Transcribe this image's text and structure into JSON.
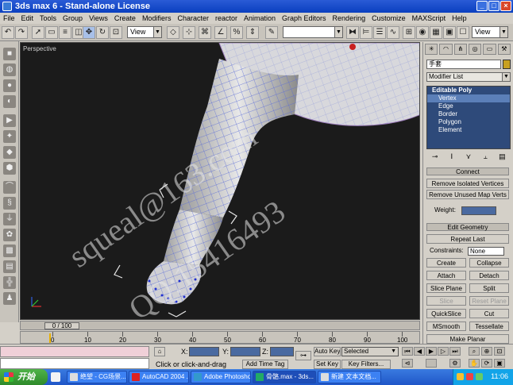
{
  "window": {
    "title": "3ds max 6 - Stand-alone License",
    "controls": [
      "_",
      "□",
      "×"
    ]
  },
  "menu": [
    "File",
    "Edit",
    "Tools",
    "Group",
    "Views",
    "Create",
    "Modifiers",
    "Character",
    "reactor",
    "Animation",
    "Graph Editors",
    "Rendering",
    "Customize",
    "MAXScript",
    "Help"
  ],
  "toolbar": {
    "view_select_1": "View",
    "view_select_2": "View"
  },
  "viewport": {
    "label": "Perspective",
    "watermark_1": "squeal@163.com",
    "watermark_2": "QQ:15416493"
  },
  "command_panel": {
    "object_name": "手套",
    "modifier_list": "Modifier List",
    "stack": {
      "top": "Editable Poly",
      "items": [
        "Vertex",
        "Edge",
        "Border",
        "Polygon",
        "Element"
      ],
      "selected": "Vertex"
    },
    "rollout_top": "Connect",
    "remove_isolated": "Remove Isolated Vertices",
    "remove_unused": "Remove Unused Map Verts",
    "weight_label": "Weight:",
    "edit_geometry": "Edit Geometry",
    "repeat_last": "Repeat Last",
    "constraints_label": "Constraints:",
    "constraints_value": "None",
    "create": "Create",
    "collapse": "Collapse",
    "attach": "Attach",
    "detach": "Detach",
    "slice_plane": "Slice Plane",
    "split": "Split",
    "slice": "Slice",
    "reset_plane": "Reset Plane",
    "quickslice": "QuickSlice",
    "cut": "Cut",
    "msmooth": "MSmooth",
    "tessellate": "Tessellate",
    "make_planar": "Make Planar"
  },
  "timeline": {
    "slider": "0 / 100",
    "ticks": [
      "0",
      "10",
      "20",
      "30",
      "40",
      "50",
      "60",
      "70",
      "80",
      "90",
      "100"
    ]
  },
  "status": {
    "x_label": "X:",
    "y_label": "Y:",
    "z_label": "Z:",
    "prompt": "Click or click-and-drag",
    "add_time_tag": "Add Time Tag",
    "auto_key": "Auto Key",
    "set_key": "Set Key",
    "selected": "Selected",
    "key_filters": "Key Filters..."
  },
  "taskbar": {
    "start": "开始",
    "tasks": [
      "绝望 - CG场景...",
      "AutoCAD 2004 ...",
      "Adobe Photoshop",
      "骨骼.max - 3ds...",
      "新建 文本文档..."
    ],
    "active_task": "骨骼.max - 3ds...",
    "clock": "11:06"
  }
}
